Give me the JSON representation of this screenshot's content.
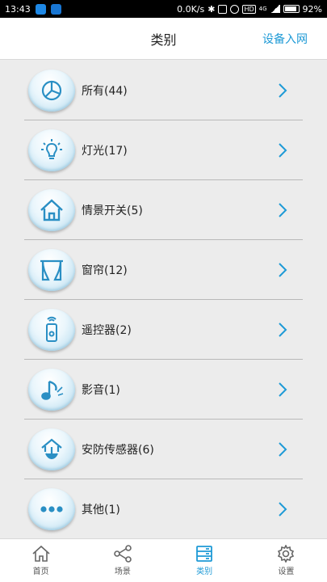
{
  "status_bar": {
    "time": "13:43",
    "net_speed": "0.0K/s",
    "network": "4G",
    "battery": "92%"
  },
  "header": {
    "title": "类别",
    "action": "设备入网"
  },
  "categories": [
    {
      "label": "所有(44)",
      "icon": "pie-chart-icon"
    },
    {
      "label": "灯光(17)",
      "icon": "light-bulb-icon"
    },
    {
      "label": "情景开关(5)",
      "icon": "house-icon"
    },
    {
      "label": "窗帘(12)",
      "icon": "curtain-icon"
    },
    {
      "label": "遥控器(2)",
      "icon": "remote-control-icon"
    },
    {
      "label": "影音(1)",
      "icon": "music-note-icon"
    },
    {
      "label": "安防传感器(6)",
      "icon": "security-house-icon"
    },
    {
      "label": "其他(1)",
      "icon": "more-dots-icon"
    }
  ],
  "tabs": [
    {
      "label": "首页",
      "icon": "home-icon",
      "active": false
    },
    {
      "label": "场景",
      "icon": "share-icon",
      "active": false
    },
    {
      "label": "类别",
      "icon": "category-list-icon",
      "active": true
    },
    {
      "label": "设置",
      "icon": "gear-icon",
      "active": false
    }
  ],
  "colors": {
    "accent": "#1e9ad6",
    "icon_stroke": "#2a8fc4",
    "background": "#ececec"
  }
}
